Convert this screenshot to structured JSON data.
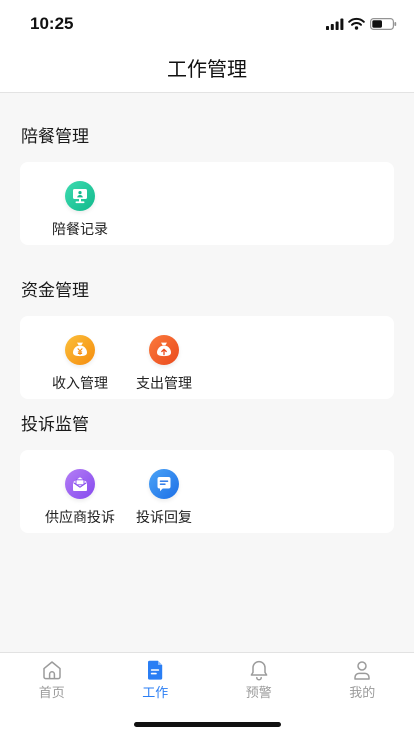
{
  "status_bar": {
    "time": "10:25",
    "battery_level": 0.5
  },
  "header": {
    "title": "工作管理"
  },
  "sections": [
    {
      "title": "陪餐管理",
      "items": [
        {
          "label": "陪餐记录",
          "icon": "monitor-icon",
          "color_from": "#3ddbb0",
          "color_to": "#12b98c"
        }
      ]
    },
    {
      "title": "资金管理",
      "items": [
        {
          "label": "收入管理",
          "icon": "money-bag-yuan-icon",
          "color_from": "#fbbf3a",
          "color_to": "#f58c0e"
        },
        {
          "label": "支出管理",
          "icon": "money-bag-up-icon",
          "color_from": "#fb7a3c",
          "color_to": "#ea4a1d"
        }
      ]
    },
    {
      "title": "投诉监管",
      "items": [
        {
          "label": "供应商投诉",
          "icon": "envelope-icon",
          "color_from": "#b47ef5",
          "color_to": "#8549ee"
        },
        {
          "label": "投诉回复",
          "icon": "chat-bubble-icon",
          "color_from": "#4aa3f7",
          "color_to": "#1d6fe6"
        }
      ]
    }
  ],
  "tab_bar": {
    "items": [
      {
        "label": "首页",
        "icon": "home-icon",
        "active": false
      },
      {
        "label": "工作",
        "icon": "document-icon",
        "active": true
      },
      {
        "label": "预警",
        "icon": "bell-icon",
        "active": false
      },
      {
        "label": "我的",
        "icon": "user-icon",
        "active": false
      }
    ]
  },
  "colors": {
    "accent": "#2a7ef4",
    "inactive": "#9b9b9b",
    "background": "#f7f7f7",
    "card": "#ffffff"
  }
}
